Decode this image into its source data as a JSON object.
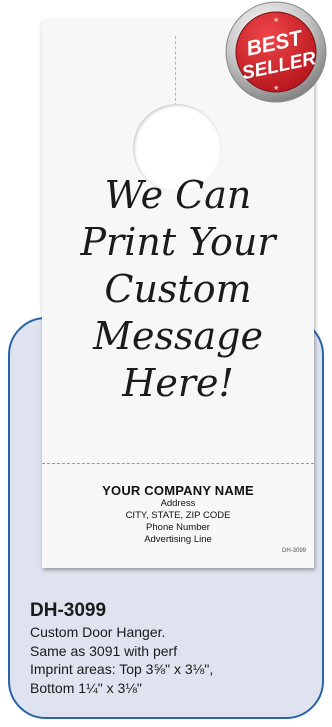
{
  "hanger": {
    "message_lines": [
      "We Can",
      "Print Your",
      "Custom",
      "Message",
      "Here!"
    ],
    "company_name": "YOUR COMPANY NAME",
    "address": "Address",
    "city_state_zip": "CITY, STATE, ZIP CODE",
    "phone": "Phone Number",
    "advertising": "Advertising Line",
    "small_code": "DH-3099"
  },
  "badge": {
    "line1": "BEST",
    "line2": "SELLER"
  },
  "product": {
    "sku": "DH-3099",
    "description_lines": [
      "Custom Door Hanger.",
      "Same as 3091 with perf",
      "Imprint areas:  Top 3⅝\" x 3⅛\",",
      "Bottom 1¼\" x 3⅛\""
    ]
  },
  "colors": {
    "card_border": "#2a64a8",
    "card_fill": "#dfe3ef",
    "badge_red": "#d8262c"
  }
}
